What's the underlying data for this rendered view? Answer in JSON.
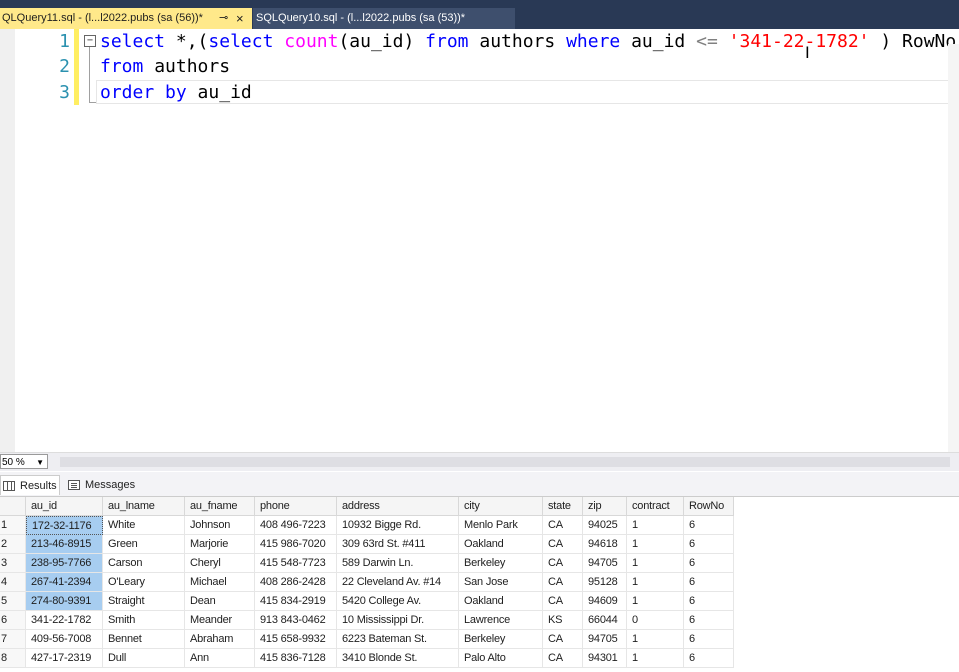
{
  "tabs": [
    {
      "label": "QLQuery11.sql - (l...l2022.pubs (sa (56))*",
      "active": true
    },
    {
      "label": "SQLQuery10.sql - (l...l2022.pubs (sa (53))*",
      "active": false
    }
  ],
  "icons": {
    "pin": "pin-icon",
    "close": "close-icon"
  },
  "editor": {
    "line_numbers": [
      "1",
      "2",
      "3"
    ],
    "line1": {
      "kw_select": "select",
      "t1": " *,(",
      "kw_select2": "select",
      "sp1": " ",
      "fn_count": "count",
      "t2": "(au_id) ",
      "kw_from": "from",
      "t3": " authors ",
      "kw_where": "where",
      "t4": " au_id ",
      "op_le": "<=",
      "sp2": " ",
      "str_val": "'341-22-1782'",
      "t5": " ) RowNo"
    },
    "line2": {
      "kw_from": "from",
      "t1": " authors"
    },
    "line3": {
      "kw_order": "order",
      "sp": " ",
      "kw_by": "by",
      "t1": " au_id"
    }
  },
  "zoom": {
    "value": "50 %"
  },
  "results_tabs": {
    "results": "Results",
    "messages": "Messages"
  },
  "grid": {
    "columns": [
      "",
      "au_id",
      "au_lname",
      "au_fname",
      "phone",
      "address",
      "city",
      "state",
      "zip",
      "contract",
      "RowNo"
    ],
    "rows": [
      [
        "1",
        "172-32-1176",
        "White",
        "Johnson",
        "408 496-7223",
        "10932 Bigge Rd.",
        "Menlo Park",
        "CA",
        "94025",
        "1",
        "6"
      ],
      [
        "2",
        "213-46-8915",
        "Green",
        "Marjorie",
        "415 986-7020",
        "309 63rd St. #411",
        "Oakland",
        "CA",
        "94618",
        "1",
        "6"
      ],
      [
        "3",
        "238-95-7766",
        "Carson",
        "Cheryl",
        "415 548-7723",
        "589 Darwin Ln.",
        "Berkeley",
        "CA",
        "94705",
        "1",
        "6"
      ],
      [
        "4",
        "267-41-2394",
        "O'Leary",
        "Michael",
        "408 286-2428",
        "22 Cleveland Av. #14",
        "San Jose",
        "CA",
        "95128",
        "1",
        "6"
      ],
      [
        "5",
        "274-80-9391",
        "Straight",
        "Dean",
        "415 834-2919",
        "5420 College Av.",
        "Oakland",
        "CA",
        "94609",
        "1",
        "6"
      ],
      [
        "6",
        "341-22-1782",
        "Smith",
        "Meander",
        "913 843-0462",
        "10 Mississippi Dr.",
        "Lawrence",
        "KS",
        "66044",
        "0",
        "6"
      ],
      [
        "7",
        "409-56-7008",
        "Bennet",
        "Abraham",
        "415 658-9932",
        "6223 Bateman St.",
        "Berkeley",
        "CA",
        "94705",
        "1",
        "6"
      ],
      [
        "8",
        "427-17-2319",
        "Dull",
        "Ann",
        "415 836-7128",
        "3410 Blonde St.",
        "Palo Alto",
        "CA",
        "94301",
        "1",
        "6"
      ]
    ],
    "selected_rows": [
      0,
      1,
      2,
      3,
      4
    ],
    "selection_color": "#a7cdf0"
  }
}
